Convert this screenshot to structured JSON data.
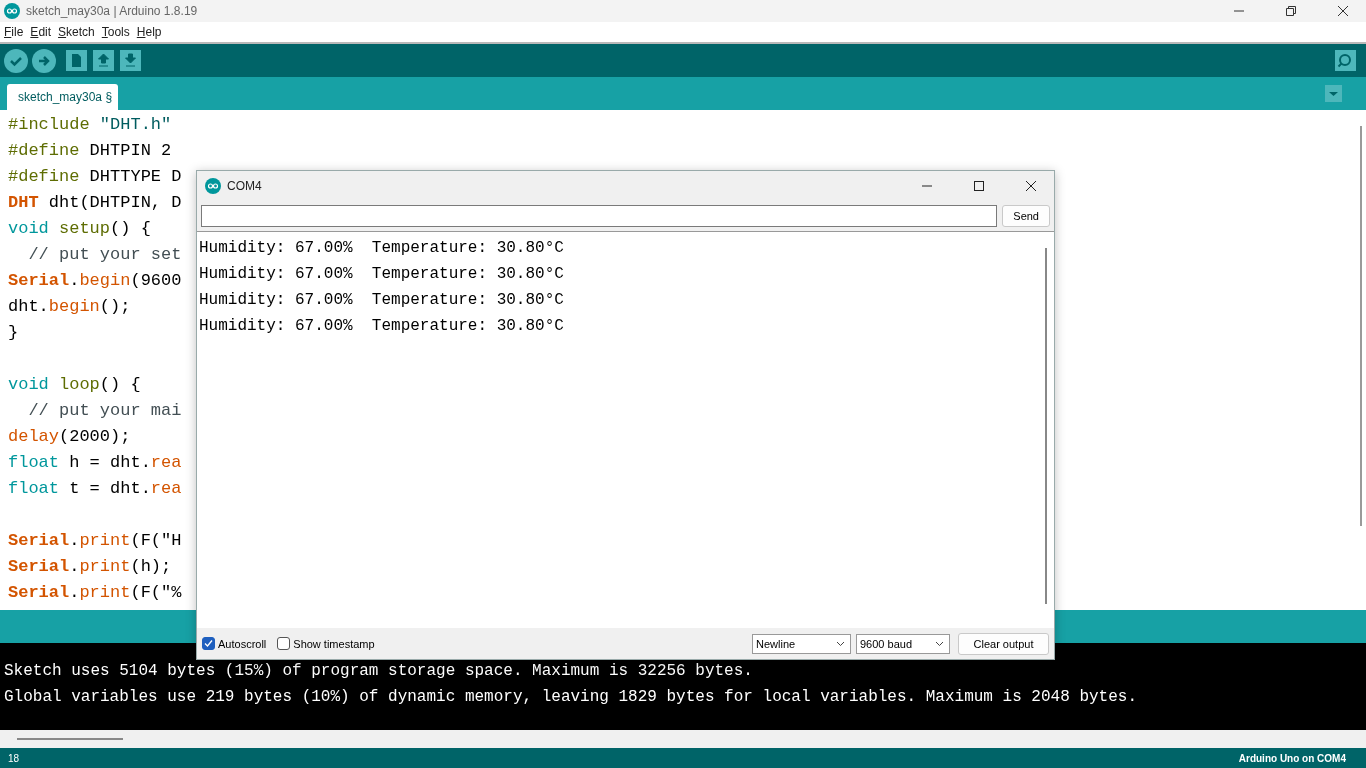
{
  "window": {
    "title": "sketch_may30a | Arduino 1.8.19"
  },
  "menu": [
    {
      "label": "File"
    },
    {
      "label": "Edit"
    },
    {
      "label": "Sketch"
    },
    {
      "label": "Tools"
    },
    {
      "label": "Help"
    }
  ],
  "tabs": [
    {
      "label": "sketch_may30a §",
      "selected": true
    }
  ],
  "editor": {
    "lines": [
      {
        "kind": "code",
        "segments": [
          {
            "kind": "directive",
            "text": "#include"
          },
          {
            "kind": "string",
            "text": " \"DHT.h\""
          }
        ]
      },
      {
        "kind": "code",
        "segments": [
          {
            "kind": "directive",
            "text": "#define"
          },
          {
            "kind": "plain",
            "text": " DHTPIN 2"
          }
        ]
      },
      {
        "kind": "code",
        "segments": [
          {
            "kind": "directive",
            "text": "#define"
          },
          {
            "kind": "plain",
            "text": " DHTTYPE D"
          }
        ]
      },
      {
        "kind": "code",
        "segments": [
          {
            "kind": "class",
            "text": "DHT"
          },
          {
            "kind": "plain",
            "text": " dht(DHTPIN, D"
          }
        ]
      },
      {
        "kind": "code",
        "segments": [
          {
            "kind": "type",
            "text": "void"
          },
          {
            "kind": "function",
            "text": " setup"
          },
          {
            "kind": "plain",
            "text": "() {"
          }
        ]
      },
      {
        "kind": "code",
        "segments": [
          {
            "kind": "comment",
            "text": "  // put your set"
          }
        ]
      },
      {
        "kind": "code",
        "segments": [
          {
            "kind": "class",
            "text": "Serial"
          },
          {
            "kind": "plain",
            "text": "."
          },
          {
            "kind": "method",
            "text": "begin"
          },
          {
            "kind": "plain",
            "text": "(9600"
          }
        ]
      },
      {
        "kind": "code",
        "segments": [
          {
            "kind": "plain",
            "text": "dht."
          },
          {
            "kind": "method",
            "text": "begin"
          },
          {
            "kind": "plain",
            "text": "();"
          }
        ]
      },
      {
        "kind": "code",
        "segments": [
          {
            "kind": "plain",
            "text": "}"
          }
        ]
      },
      {
        "kind": "blank"
      },
      {
        "kind": "code",
        "segments": [
          {
            "kind": "type",
            "text": "void"
          },
          {
            "kind": "function",
            "text": " loop"
          },
          {
            "kind": "plain",
            "text": "() {"
          }
        ]
      },
      {
        "kind": "code",
        "segments": [
          {
            "kind": "comment",
            "text": "  // put your mai"
          }
        ]
      },
      {
        "kind": "code",
        "segments": [
          {
            "kind": "method",
            "text": "delay"
          },
          {
            "kind": "plain",
            "text": "(2000);"
          }
        ]
      },
      {
        "kind": "code",
        "segments": [
          {
            "kind": "type",
            "text": "float"
          },
          {
            "kind": "plain",
            "text": " h = dht."
          },
          {
            "kind": "method",
            "text": "rea"
          }
        ]
      },
      {
        "kind": "code",
        "segments": [
          {
            "kind": "type",
            "text": "float"
          },
          {
            "kind": "plain",
            "text": " t = dht."
          },
          {
            "kind": "method",
            "text": "rea"
          }
        ]
      },
      {
        "kind": "blank"
      },
      {
        "kind": "code",
        "segments": [
          {
            "kind": "class",
            "text": "Serial"
          },
          {
            "kind": "plain",
            "text": "."
          },
          {
            "kind": "method",
            "text": "print"
          },
          {
            "kind": "plain",
            "text": "(F(\"H"
          }
        ]
      },
      {
        "kind": "code",
        "segments": [
          {
            "kind": "class",
            "text": "Serial"
          },
          {
            "kind": "plain",
            "text": "."
          },
          {
            "kind": "method",
            "text": "print"
          },
          {
            "kind": "plain",
            "text": "(h);"
          }
        ]
      },
      {
        "kind": "code",
        "segments": [
          {
            "kind": "class",
            "text": "Serial"
          },
          {
            "kind": "plain",
            "text": "."
          },
          {
            "kind": "method",
            "text": "print"
          },
          {
            "kind": "plain",
            "text": "(F(\"%"
          }
        ]
      }
    ]
  },
  "console": {
    "lines": [
      "Sketch uses 5104 bytes (15%) of program storage space. Maximum is 32256 bytes.",
      "Global variables use 219 bytes (10%) of dynamic memory, leaving 1829 bytes for local variables. Maximum is 2048 bytes."
    ]
  },
  "serial_monitor": {
    "title": "COM4",
    "send_button": "Send",
    "output": [
      "Humidity: 67.00%  Temperature: 30.80°C",
      "Humidity: 67.00%  Temperature: 30.80°C",
      "Humidity: 67.00%  Temperature: 30.80°C",
      "Humidity: 67.00%  Temperature: 30.80°C"
    ],
    "autoscroll": {
      "label": "Autoscroll",
      "checked": true
    },
    "timestamp": {
      "label": "Show timestamp",
      "checked": false
    },
    "line_ending": "Newline",
    "baud_rate": "9600 baud",
    "clear_button": "Clear output"
  },
  "status_bar": {
    "line": "18",
    "board": "Arduino Uno on COM4"
  }
}
